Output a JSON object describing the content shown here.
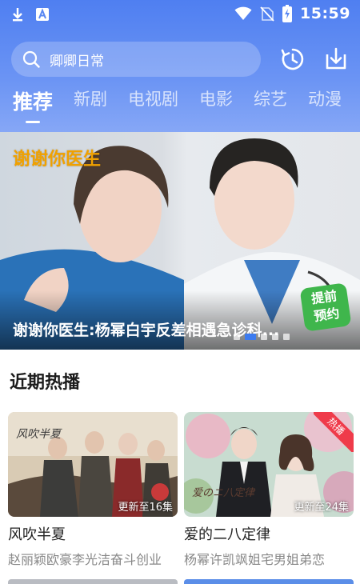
{
  "status_bar": {
    "time": "15:59",
    "left_icons": [
      "download-icon",
      "a-badge-icon"
    ],
    "right_icons": [
      "wifi-icon",
      "no-sim-icon",
      "battery-icon"
    ]
  },
  "search": {
    "placeholder": "卿卿日常"
  },
  "header_actions": [
    "history-icon",
    "download-icon"
  ],
  "tabs": [
    {
      "label": "推荐",
      "active": true
    },
    {
      "label": "新剧"
    },
    {
      "label": "电视剧"
    },
    {
      "label": "电影"
    },
    {
      "label": "综艺"
    },
    {
      "label": "动漫"
    }
  ],
  "banner": {
    "tag": "谢谢你医生",
    "caption": "谢谢你医生:杨幂白宇反差相遇急诊科...",
    "badge": "提前\n预约",
    "slides": 5,
    "active_slide": 1
  },
  "section": {
    "title": "近期热播"
  },
  "cards": [
    {
      "title": "风吹半夏",
      "subtitle": "赵丽颖欧豪李光洁奋斗创业",
      "update": "更新至16集"
    },
    {
      "title": "爱的二八定律",
      "subtitle": "杨幂许凯飒姐宅男姐弟恋",
      "update": "更新至24集",
      "hot_label": "热播"
    }
  ],
  "colors": {
    "header": "#5a88f2",
    "accent": "#3d7cf0",
    "hot": "#ef3b4a",
    "badge": "#3fb64c"
  }
}
